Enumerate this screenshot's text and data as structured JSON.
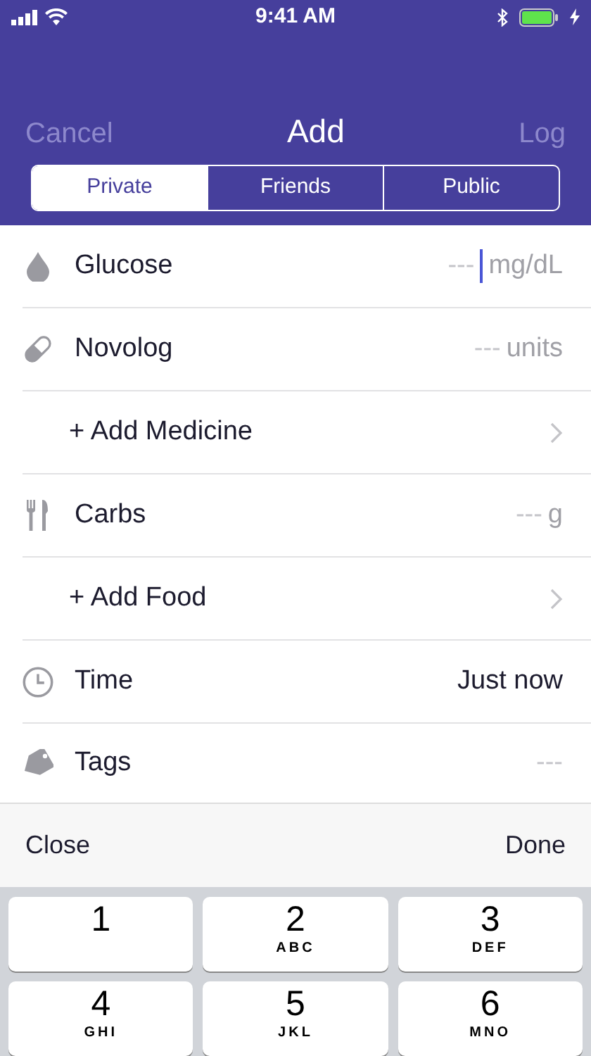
{
  "status_bar": {
    "time": "9:41 AM"
  },
  "nav": {
    "cancel": "Cancel",
    "title": "Add",
    "log": "Log"
  },
  "tabs": [
    {
      "label": "Private",
      "selected": true
    },
    {
      "label": "Friends",
      "selected": false
    },
    {
      "label": "Public",
      "selected": false
    }
  ],
  "rows": [
    {
      "kind": "entry",
      "label": "Glucose",
      "placeholder": "---",
      "unit": "mg/dL",
      "focused": true
    },
    {
      "kind": "entry",
      "label": "Novolog",
      "placeholder": "---",
      "unit": "units",
      "focused": false
    },
    {
      "kind": "link",
      "label": "+ Add Medicine"
    },
    {
      "kind": "entry",
      "label": "Carbs",
      "placeholder": "---",
      "unit": "g",
      "focused": false
    },
    {
      "kind": "link",
      "label": "+ Add Food"
    },
    {
      "kind": "value",
      "label": "Time",
      "value": "Just now"
    },
    {
      "kind": "entry",
      "label": "Tags",
      "placeholder": "---",
      "focused": false
    }
  ],
  "toolbar": {
    "close": "Close",
    "done": "Done"
  },
  "keys": [
    {
      "digit": "1"
    },
    {
      "digit": "2",
      "letters": "ABC"
    },
    {
      "digit": "3",
      "letters": "DEF"
    },
    {
      "digit": "4",
      "letters": "GHI"
    },
    {
      "digit": "5",
      "letters": "JKL"
    },
    {
      "digit": "6",
      "letters": "MNO"
    }
  ]
}
